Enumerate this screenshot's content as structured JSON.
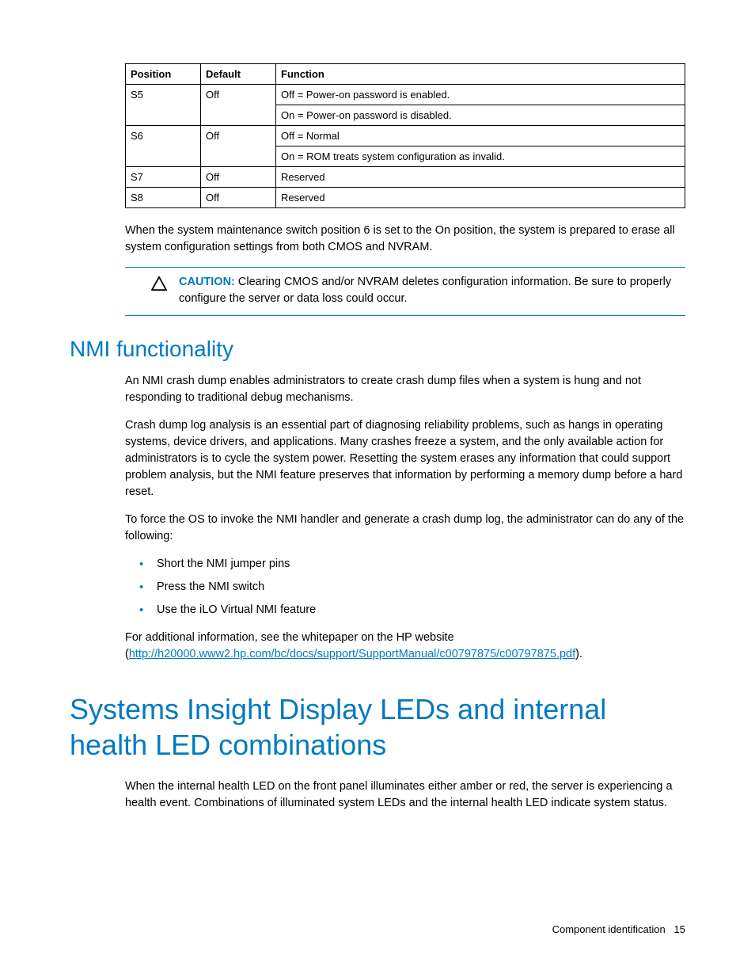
{
  "table": {
    "headers": {
      "position": "Position",
      "default": "Default",
      "function": "Function"
    },
    "rows": [
      {
        "pos": "S5",
        "def": "Off",
        "fn1": "Off = Power-on password is enabled.",
        "fn2": "On = Power-on password is disabled."
      },
      {
        "pos": "S6",
        "def": "Off",
        "fn1": "Off = Normal",
        "fn2": "On = ROM treats system configuration as invalid."
      },
      {
        "pos": "S7",
        "def": "Off",
        "fn1": "Reserved"
      },
      {
        "pos": "S8",
        "def": "Off",
        "fn1": "Reserved"
      }
    ]
  },
  "para_after_table": "When the system maintenance switch position 6 is set to the On position, the system is prepared to erase all system configuration settings from both CMOS and NVRAM.",
  "caution": {
    "label": "CAUTION:",
    "text": "Clearing CMOS and/or NVRAM deletes configuration information. Be sure to properly configure the server or data loss could occur."
  },
  "nmi": {
    "heading": "NMI functionality",
    "p1": "An NMI crash dump enables administrators to create crash dump files when a system is hung and not responding to traditional debug mechanisms.",
    "p2": "Crash dump log analysis is an essential part of diagnosing reliability problems, such as hangs in operating systems, device drivers, and applications. Many crashes freeze a system, and the only available action for administrators is to cycle the system power. Resetting the system erases any information that could support problem analysis, but the NMI feature preserves that information by performing a memory dump before a hard reset.",
    "p3": "To force the OS to invoke the NMI handler and generate a crash dump log, the administrator can do any of the following:",
    "bullets": [
      "Short the NMI jumper pins",
      "Press the NMI switch",
      "Use the iLO Virtual NMI feature"
    ],
    "p4_prefix": "For additional information, see the whitepaper on the HP website (",
    "p4_link": "http://h20000.www2.hp.com/bc/docs/support/SupportManual/c00797875/c00797875.pdf",
    "p4_suffix": ")."
  },
  "sid": {
    "heading": "Systems Insight Display LEDs and internal health LED combinations",
    "p1": "When the internal health LED on the front panel illuminates either amber or red, the server is experiencing a health event. Combinations of illuminated system LEDs and the internal health LED indicate system status."
  },
  "footer": {
    "section": "Component identification",
    "page": "15"
  }
}
